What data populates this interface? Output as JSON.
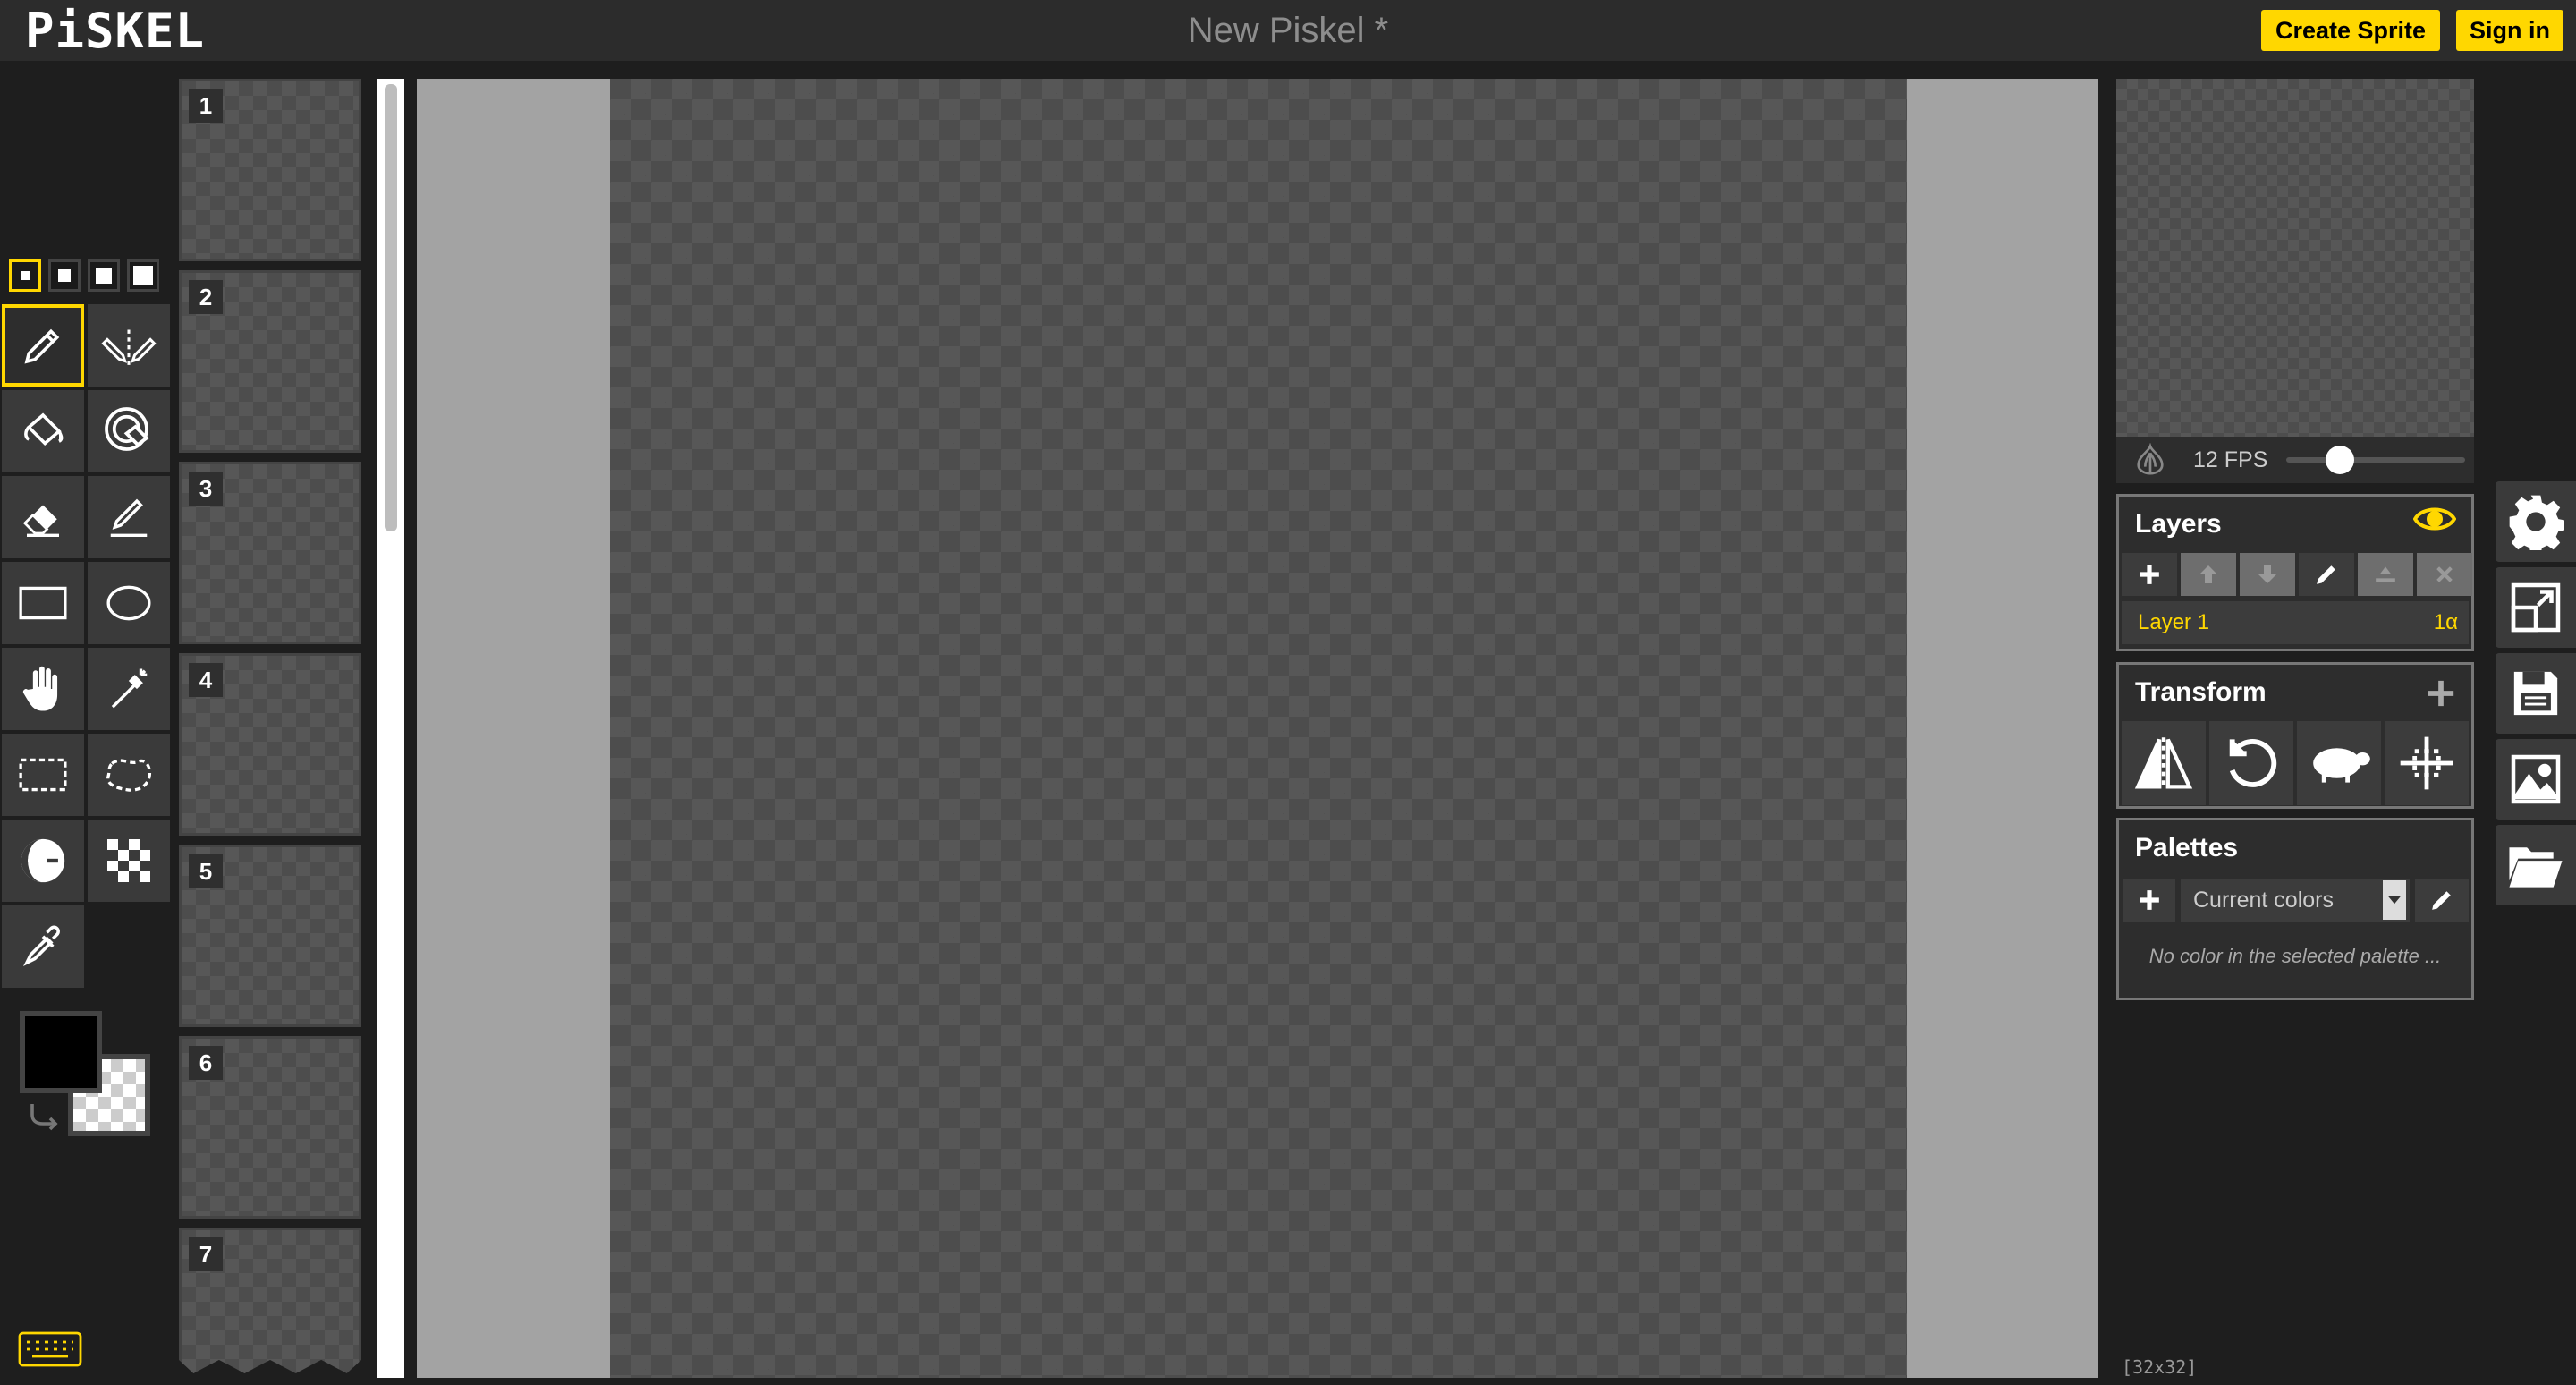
{
  "app": {
    "logo": "PiSKEL",
    "document_title": "New Piskel *"
  },
  "header": {
    "create_label": "Create Sprite",
    "signin_label": "Sign in"
  },
  "pen_sizes": [
    "1",
    "2",
    "3",
    "4"
  ],
  "tools": [
    {
      "name": "pen-tool",
      "icon": "pencil-icon"
    },
    {
      "name": "vertical-mirror-pen-tool",
      "icon": "mirror-pen-icon"
    },
    {
      "name": "paint-bucket-tool",
      "icon": "bucket-icon"
    },
    {
      "name": "paint-all-same-color-tool",
      "icon": "target-bucket-icon"
    },
    {
      "name": "eraser-tool",
      "icon": "eraser-icon"
    },
    {
      "name": "stroke-tool",
      "icon": "line-icon"
    },
    {
      "name": "rectangle-tool",
      "icon": "rectangle-icon"
    },
    {
      "name": "circle-tool",
      "icon": "circle-icon"
    },
    {
      "name": "move-tool",
      "icon": "hand-icon"
    },
    {
      "name": "shape-selection-tool",
      "icon": "magic-wand-icon"
    },
    {
      "name": "rectangle-selection-tool",
      "icon": "dashed-rect-icon"
    },
    {
      "name": "lasso-selection-tool",
      "icon": "lasso-icon"
    },
    {
      "name": "lighten-tool",
      "icon": "lighten-icon"
    },
    {
      "name": "dithering-tool",
      "icon": "checker-icon"
    },
    {
      "name": "color-picker-tool",
      "icon": "eyedropper-icon"
    }
  ],
  "frames": [
    "1",
    "2",
    "3",
    "4",
    "5",
    "6",
    "7"
  ],
  "preview": {
    "fps_label": "12 FPS",
    "fps": 12,
    "fps_fraction": 0.3
  },
  "layers": {
    "title": "Layers",
    "items": [
      {
        "name": "Layer 1",
        "opacity": "1α"
      }
    ]
  },
  "transform": {
    "title": "Transform"
  },
  "palettes": {
    "title": "Palettes",
    "selected": "Current colors",
    "empty_message": "No color in the selected palette ..."
  },
  "status": {
    "resolution": "[32x32]"
  },
  "colors": {
    "accent": "#ffd700",
    "primary": "#000000",
    "secondary": "transparent"
  }
}
